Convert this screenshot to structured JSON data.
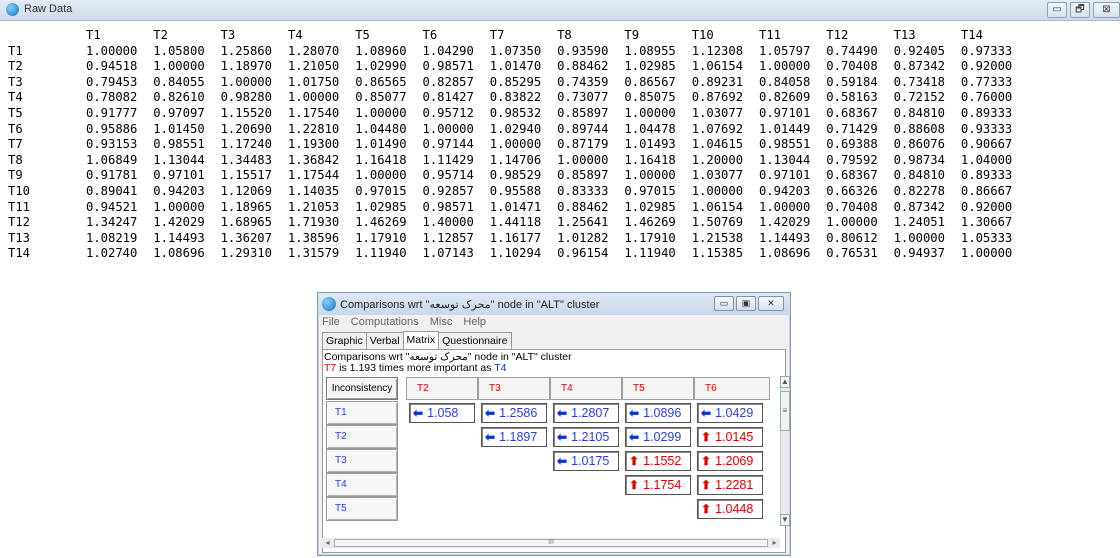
{
  "raw_window": {
    "title": "Raw Data",
    "buttons": [
      "▭",
      "🗗",
      "⊠"
    ]
  },
  "raw_table": {
    "headers": [
      "T1",
      "T2",
      "T3",
      "T4",
      "T5",
      "T6",
      "T7",
      "T8",
      "T9",
      "T10",
      "T11",
      "T12",
      "T13",
      "T14"
    ],
    "rows": [
      {
        "label": "T1",
        "values": [
          "1.00000",
          "1.05800",
          "1.25860",
          "1.28070",
          "1.08960",
          "1.04290",
          "1.07350",
          "0.93590",
          "1.08955",
          "1.12308",
          "1.05797",
          "0.74490",
          "0.92405",
          "0.97333"
        ]
      },
      {
        "label": "T2",
        "values": [
          "0.94518",
          "1.00000",
          "1.18970",
          "1.21050",
          "1.02990",
          "0.98571",
          "1.01470",
          "0.88462",
          "1.02985",
          "1.06154",
          "1.00000",
          "0.70408",
          "0.87342",
          "0.92000"
        ]
      },
      {
        "label": "T3",
        "values": [
          "0.79453",
          "0.84055",
          "1.00000",
          "1.01750",
          "0.86565",
          "0.82857",
          "0.85295",
          "0.74359",
          "0.86567",
          "0.89231",
          "0.84058",
          "0.59184",
          "0.73418",
          "0.77333"
        ]
      },
      {
        "label": "T4",
        "values": [
          "0.78082",
          "0.82610",
          "0.98280",
          "1.00000",
          "0.85077",
          "0.81427",
          "0.83822",
          "0.73077",
          "0.85075",
          "0.87692",
          "0.82609",
          "0.58163",
          "0.72152",
          "0.76000"
        ]
      },
      {
        "label": "T5",
        "values": [
          "0.91777",
          "0.97097",
          "1.15520",
          "1.17540",
          "1.00000",
          "0.95712",
          "0.98532",
          "0.85897",
          "1.00000",
          "1.03077",
          "0.97101",
          "0.68367",
          "0.84810",
          "0.89333"
        ]
      },
      {
        "label": "T6",
        "values": [
          "0.95886",
          "1.01450",
          "1.20690",
          "1.22810",
          "1.04480",
          "1.00000",
          "1.02940",
          "0.89744",
          "1.04478",
          "1.07692",
          "1.01449",
          "0.71429",
          "0.88608",
          "0.93333"
        ]
      },
      {
        "label": "T7",
        "values": [
          "0.93153",
          "0.98551",
          "1.17240",
          "1.19300",
          "1.01490",
          "0.97144",
          "1.00000",
          "0.87179",
          "1.01493",
          "1.04615",
          "0.98551",
          "0.69388",
          "0.86076",
          "0.90667"
        ]
      },
      {
        "label": "T8",
        "values": [
          "1.06849",
          "1.13044",
          "1.34483",
          "1.36842",
          "1.16418",
          "1.11429",
          "1.14706",
          "1.00000",
          "1.16418",
          "1.20000",
          "1.13044",
          "0.79592",
          "0.98734",
          "1.04000"
        ]
      },
      {
        "label": "T9",
        "values": [
          "0.91781",
          "0.97101",
          "1.15517",
          "1.17544",
          "1.00000",
          "0.95714",
          "0.98529",
          "0.85897",
          "1.00000",
          "1.03077",
          "0.97101",
          "0.68367",
          "0.84810",
          "0.89333"
        ]
      },
      {
        "label": "T10",
        "values": [
          "0.89041",
          "0.94203",
          "1.12069",
          "1.14035",
          "0.97015",
          "0.92857",
          "0.95588",
          "0.83333",
          "0.97015",
          "1.00000",
          "0.94203",
          "0.66326",
          "0.82278",
          "0.86667"
        ]
      },
      {
        "label": "T11",
        "values": [
          "0.94521",
          "1.00000",
          "1.18965",
          "1.21053",
          "1.02985",
          "0.98571",
          "1.01471",
          "0.88462",
          "1.02985",
          "1.06154",
          "1.00000",
          "0.70408",
          "0.87342",
          "0.92000"
        ]
      },
      {
        "label": "T12",
        "values": [
          "1.34247",
          "1.42029",
          "1.68965",
          "1.71930",
          "1.46269",
          "1.40000",
          "1.44118",
          "1.25641",
          "1.46269",
          "1.50769",
          "1.42029",
          "1.00000",
          "1.24051",
          "1.30667"
        ]
      },
      {
        "label": "T13",
        "values": [
          "1.08219",
          "1.14493",
          "1.36207",
          "1.38596",
          "1.17910",
          "1.12857",
          "1.16177",
          "1.01282",
          "1.17910",
          "1.21538",
          "1.14493",
          "0.80612",
          "1.00000",
          "1.05333"
        ]
      },
      {
        "label": "T14",
        "values": [
          "1.02740",
          "1.08696",
          "1.29310",
          "1.31579",
          "1.11940",
          "1.07143",
          "1.10294",
          "0.96154",
          "1.11940",
          "1.15385",
          "1.08696",
          "0.76531",
          "0.94937",
          "1.00000"
        ]
      }
    ]
  },
  "dialog": {
    "title": "Comparisons wrt \"محرک توسعه\" node in \"ALT\" cluster",
    "window_buttons": [
      "▭",
      "▣",
      "✕"
    ],
    "menu": [
      "File",
      "Computations",
      "Misc",
      "Help"
    ],
    "tabs": [
      "Graphic",
      "Verbal",
      "Matrix",
      "Questionnaire"
    ],
    "active_tab": "Matrix",
    "info_line1": "Comparisons wrt \"محرک توسعه\" node in \"ALT\" cluster",
    "info_line2": {
      "a": "T7",
      "middle": " is 1.193 times more important as ",
      "b": "T4"
    },
    "inconsistency_label": "Inconsistency",
    "col_headers": [
      "T2",
      "T3",
      "T4",
      "T5",
      "T6"
    ],
    "row_headers": [
      "T1",
      "T2",
      "T3",
      "T4",
      "T5"
    ],
    "cells": [
      [
        {
          "v": "1.058",
          "dir": "left"
        },
        {
          "v": "1.2586",
          "dir": "left"
        },
        {
          "v": "1.2807",
          "dir": "left"
        },
        {
          "v": "1.0896",
          "dir": "left"
        },
        {
          "v": "1.0429",
          "dir": "left"
        }
      ],
      [
        null,
        {
          "v": "1.1897",
          "dir": "left"
        },
        {
          "v": "1.2105",
          "dir": "left"
        },
        {
          "v": "1.0299",
          "dir": "left"
        },
        {
          "v": "1.0145",
          "dir": "up"
        }
      ],
      [
        null,
        null,
        {
          "v": "1.0175",
          "dir": "left"
        },
        {
          "v": "1.1552",
          "dir": "up"
        },
        {
          "v": "1.2069",
          "dir": "up"
        }
      ],
      [
        null,
        null,
        null,
        {
          "v": "1.1754",
          "dir": "up"
        },
        {
          "v": "1.2281",
          "dir": "up"
        }
      ],
      [
        null,
        null,
        null,
        null,
        {
          "v": "1.0448",
          "dir": "up"
        }
      ]
    ],
    "hscroll_thumb": "III"
  },
  "colors": {
    "blue": "#2a3fe0",
    "red": "#e00000"
  },
  "icons": {
    "left_arrow": "left-arrow-icon",
    "up_arrow": "up-arrow-icon"
  }
}
